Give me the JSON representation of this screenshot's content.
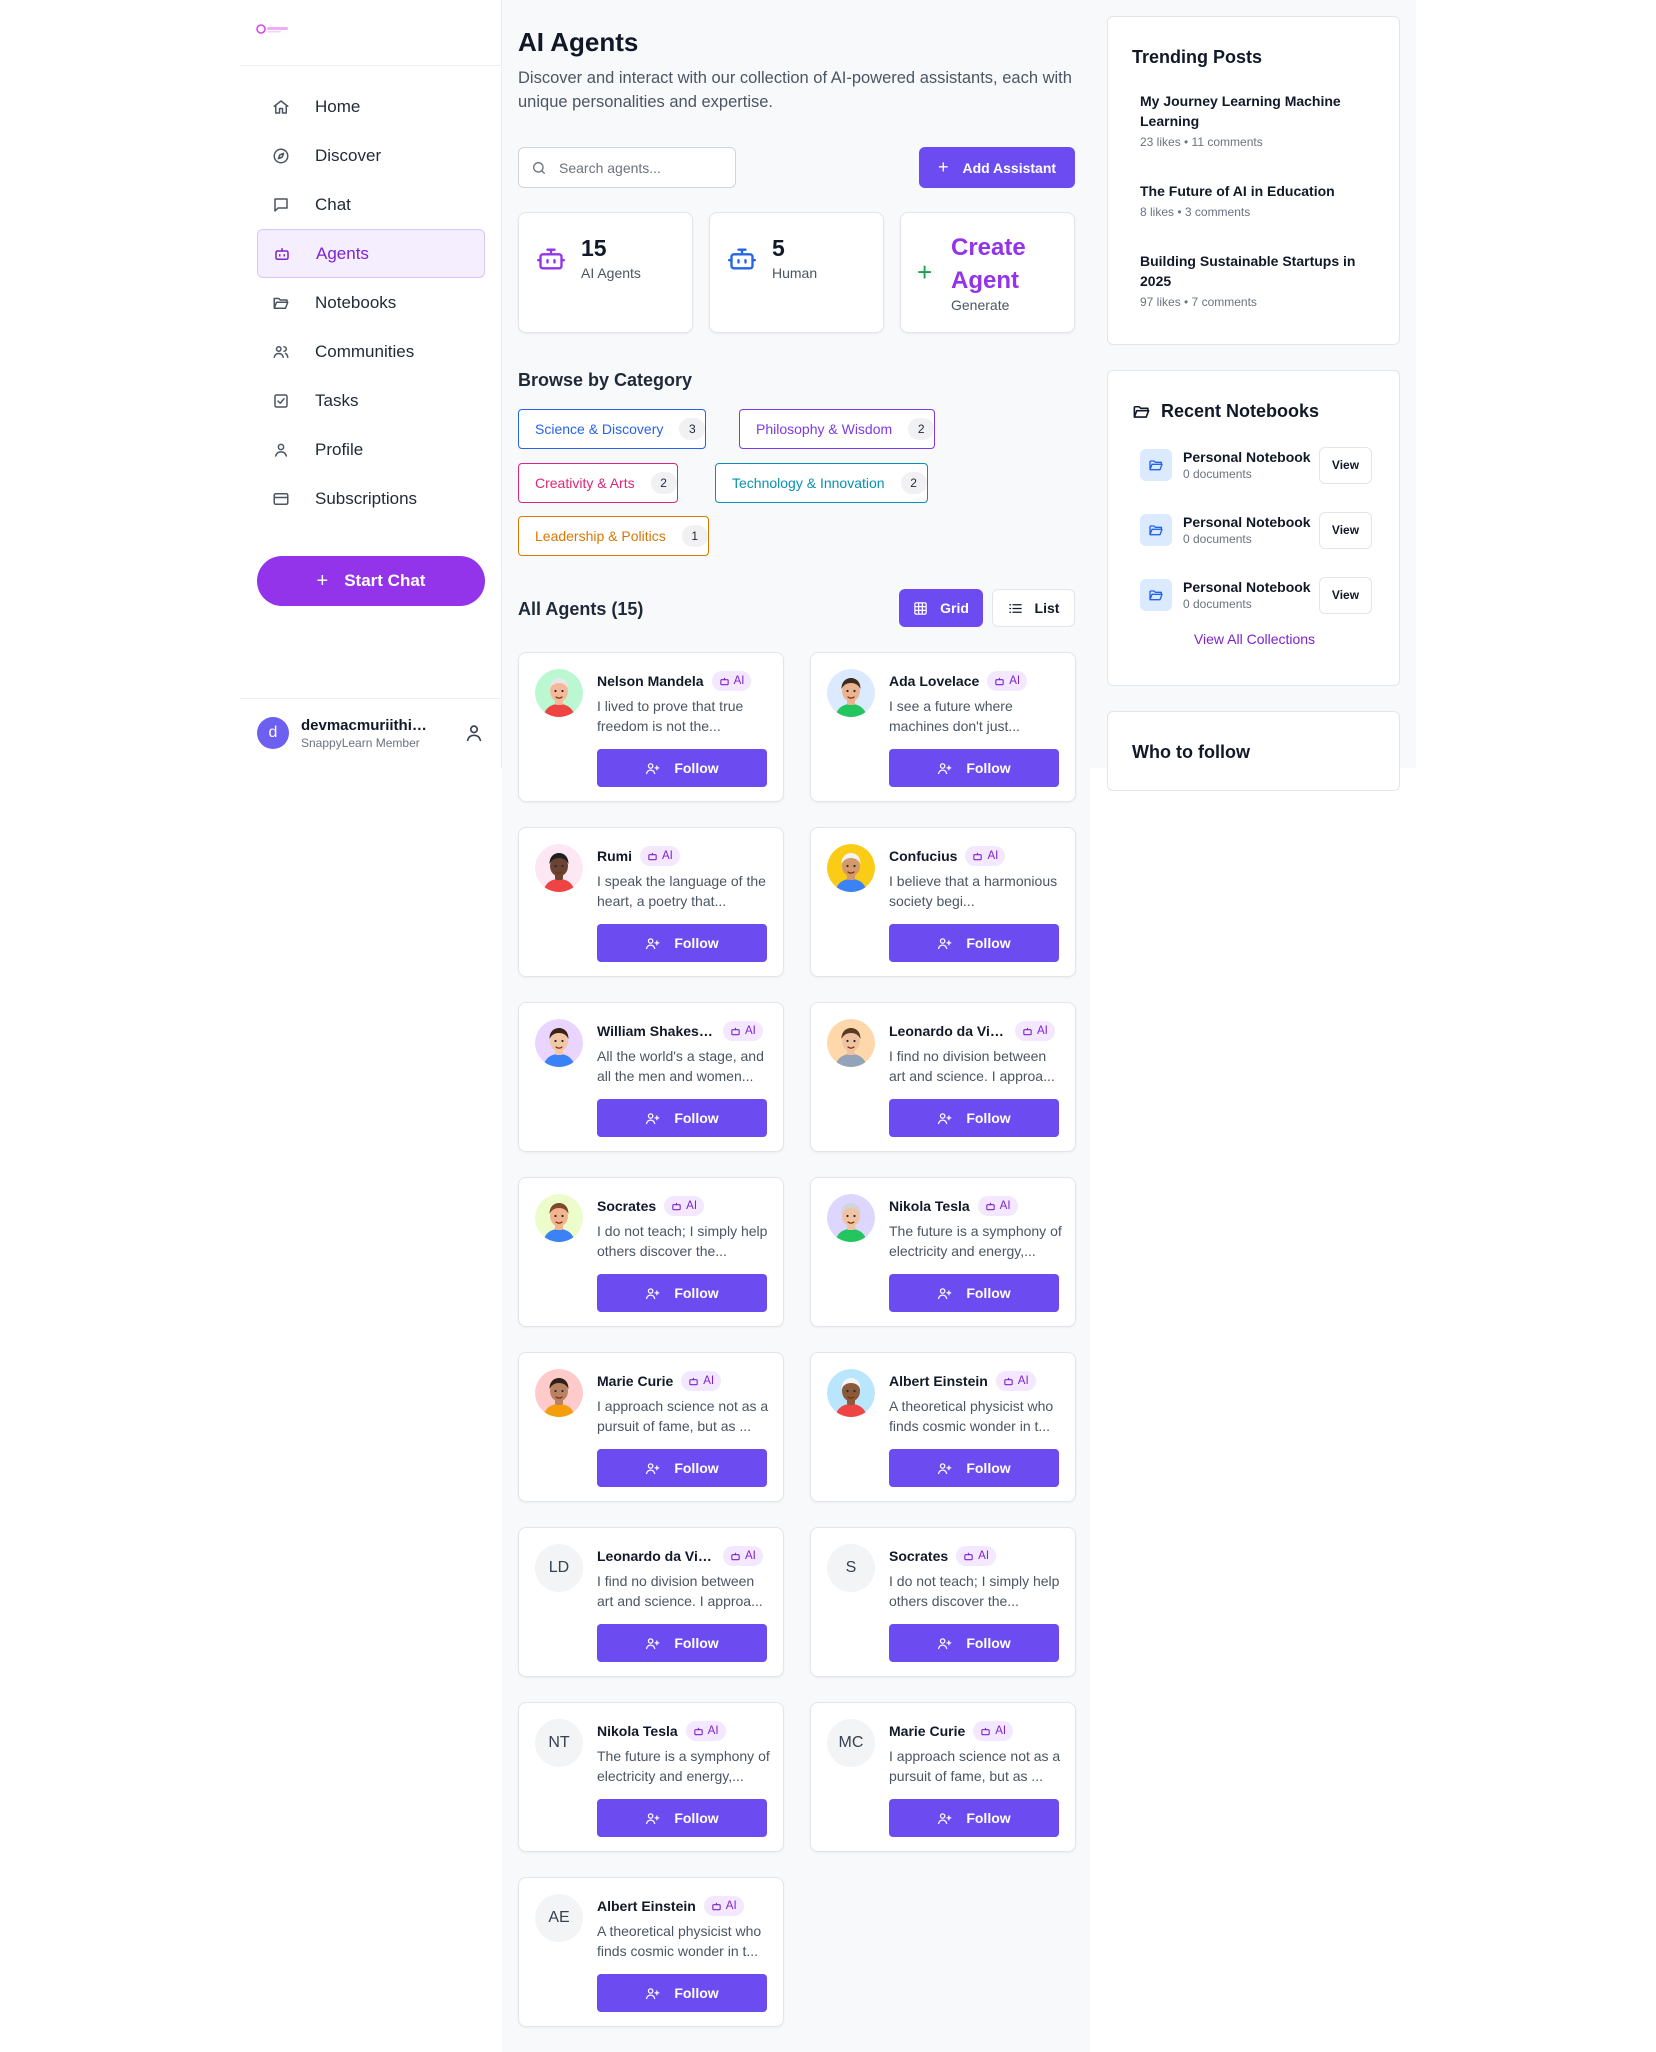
{
  "sidebar": {
    "nav": [
      {
        "label": "Home",
        "icon": "home-icon"
      },
      {
        "label": "Discover",
        "icon": "compass-icon"
      },
      {
        "label": "Chat",
        "icon": "chat-icon"
      },
      {
        "label": "Agents",
        "icon": "bot-icon",
        "active": true
      },
      {
        "label": "Notebooks",
        "icon": "folder-icon"
      },
      {
        "label": "Communities",
        "icon": "users-icon"
      },
      {
        "label": "Tasks",
        "icon": "checkbox-icon"
      },
      {
        "label": "Profile",
        "icon": "user-icon"
      },
      {
        "label": "Subscriptions",
        "icon": "card-icon"
      }
    ],
    "start_chat": "Start Chat",
    "user": {
      "initial": "d",
      "name": "devmacmuriithi@g...",
      "role": "SnappyLearn Member"
    }
  },
  "main": {
    "title": "AI Agents",
    "description": "Discover and interact with our collection of AI-powered assistants, each with unique personalities and expertise.",
    "search_placeholder": "Search agents...",
    "add_assistant": "Add Assistant",
    "stats": [
      {
        "value": "15",
        "label": "AI Agents"
      },
      {
        "value": "5",
        "label": "Human"
      }
    ],
    "create": {
      "title": "Create Agent",
      "sub": "Generate"
    },
    "browse_title": "Browse by Category",
    "categories": [
      {
        "label": "Science & Discovery",
        "count": "3",
        "color": "#2563eb"
      },
      {
        "label": "Philosophy & Wisdom",
        "count": "2",
        "color": "#7c3aed"
      },
      {
        "label": "Creativity & Arts",
        "count": "2",
        "color": "#db2777"
      },
      {
        "label": "Technology & Innovation",
        "count": "2",
        "color": "#0891b2"
      },
      {
        "label": "Leadership & Politics",
        "count": "1",
        "color": "#d97706"
      }
    ],
    "all_agents_title": "All Agents (15)",
    "view_grid": "Grid",
    "view_list": "List",
    "badge_label": "AI",
    "follow_label": "Follow",
    "agents": [
      {
        "name": "Nelson Mandela",
        "bio": "I lived to prove that true freedom is not the...",
        "avatar": "illustrated",
        "bg": "#bbf7d0",
        "skin": "#f5b99a",
        "hair": "#e5e7eb",
        "shirt": "#ef4444"
      },
      {
        "name": "Ada Lovelace",
        "bio": "I see a future where machines don't just...",
        "avatar": "illustrated",
        "bg": "#dbeafe",
        "skin": "#e9b48f",
        "hair": "#3f2a1e",
        "shirt": "#22c55e"
      },
      {
        "name": "Rumi",
        "bio": "I speak the language of the heart, a poetry that...",
        "avatar": "illustrated",
        "bg": "#fce7f3",
        "skin": "#6b4332",
        "hair": "#1f1f1f",
        "shirt": "#ef4444"
      },
      {
        "name": "Confucius",
        "bio": "I believe that a harmonious society begi...",
        "avatar": "illustrated",
        "bg": "#facc15",
        "skin": "#d49a6a",
        "hair": "#f3f4f6",
        "shirt": "#3b82f6"
      },
      {
        "name": "William Shakesp...",
        "bio": "All the world's a stage, and all the men and women...",
        "avatar": "illustrated",
        "bg": "#e9d5ff",
        "skin": "#f1c7a6",
        "hair": "#3b2417",
        "shirt": "#3b82f6"
      },
      {
        "name": "Leonardo da Vinci",
        "bio": "I find no division between art and science. I approa...",
        "avatar": "illustrated",
        "bg": "#fed7aa",
        "skin": "#f0c3a0",
        "hair": "#5a3a22",
        "shirt": "#94a3b8"
      },
      {
        "name": "Socrates",
        "bio": "I do not teach; I simply help others discover the...",
        "avatar": "illustrated",
        "bg": "#ecfccb",
        "skin": "#f2b48e",
        "hair": "#7c4a2a",
        "shirt": "#3b82f6"
      },
      {
        "name": "Nikola Tesla",
        "bio": "The future is a symphony of electricity and energy,...",
        "avatar": "illustrated",
        "bg": "#ddd6fe",
        "skin": "#efc4a4",
        "hair": "#d1d5db",
        "shirt": "#22c55e"
      },
      {
        "name": "Marie Curie",
        "bio": "I approach science not as a pursuit of fame, but as ...",
        "avatar": "illustrated",
        "bg": "#fecaca",
        "skin": "#b98260",
        "hair": "#2f2118",
        "shirt": "#f59e0b"
      },
      {
        "name": "Albert Einstein",
        "bio": "A theoretical physicist who finds cosmic wonder in t...",
        "avatar": "illustrated",
        "bg": "#bae6fd",
        "skin": "#8a5a3b",
        "hair": "#f3f4f6",
        "shirt": "#ef4444"
      },
      {
        "name": "Leonardo da Vinci",
        "bio": "I find no division between art and science. I approa...",
        "avatar": "initials",
        "initials": "LD"
      },
      {
        "name": "Socrates",
        "bio": "I do not teach; I simply help others discover the...",
        "avatar": "initials",
        "initials": "S"
      },
      {
        "name": "Nikola Tesla",
        "bio": "The future is a symphony of electricity and energy,...",
        "avatar": "initials",
        "initials": "NT"
      },
      {
        "name": "Marie Curie",
        "bio": "I approach science not as a pursuit of fame, but as ...",
        "avatar": "initials",
        "initials": "MC"
      },
      {
        "name": "Albert Einstein",
        "bio": "A theoretical physicist who finds cosmic wonder in t...",
        "avatar": "initials",
        "initials": "AE"
      }
    ]
  },
  "right": {
    "trending_title": "Trending Posts",
    "posts": [
      {
        "title": "My Journey Learning Machine Learning",
        "meta": "23 likes • 11 comments"
      },
      {
        "title": "The Future of AI in Education",
        "meta": "8 likes • 3 comments"
      },
      {
        "title": "Building Sustainable Startups in 2025",
        "meta": "97 likes • 7 comments"
      }
    ],
    "notebooks_title": "Recent Notebooks",
    "notebooks": [
      {
        "name": "Personal Notebook",
        "meta": "0 documents",
        "action": "View"
      },
      {
        "name": "Personal Notebook",
        "meta": "0 documents",
        "action": "View"
      },
      {
        "name": "Personal Notebook",
        "meta": "0 documents",
        "action": "View"
      }
    ],
    "view_all": "View All Collections",
    "who_to_follow": "Who to follow"
  }
}
